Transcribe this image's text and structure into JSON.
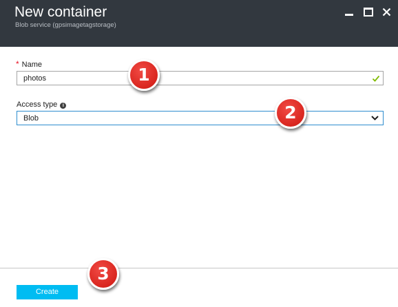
{
  "header": {
    "title": "New container",
    "subtitle": "Blob service (gpsimagetagstorage)",
    "background": "#32383f"
  },
  "window_controls": {
    "minimize_icon": "minimize-icon",
    "maximize_icon": "maximize-icon",
    "close_icon": "close-icon"
  },
  "form": {
    "name": {
      "required_marker": "*",
      "label": "Name",
      "value": "photos",
      "valid_icon": "checkmark-icon"
    },
    "access_type": {
      "label": "Access type",
      "info_icon": "info-icon",
      "selected": "Blob",
      "dropdown_icon": "chevron-down-icon"
    }
  },
  "footer": {
    "create_label": "Create",
    "accent": "#00bcf2"
  },
  "callouts": [
    "1",
    "2",
    "3"
  ]
}
